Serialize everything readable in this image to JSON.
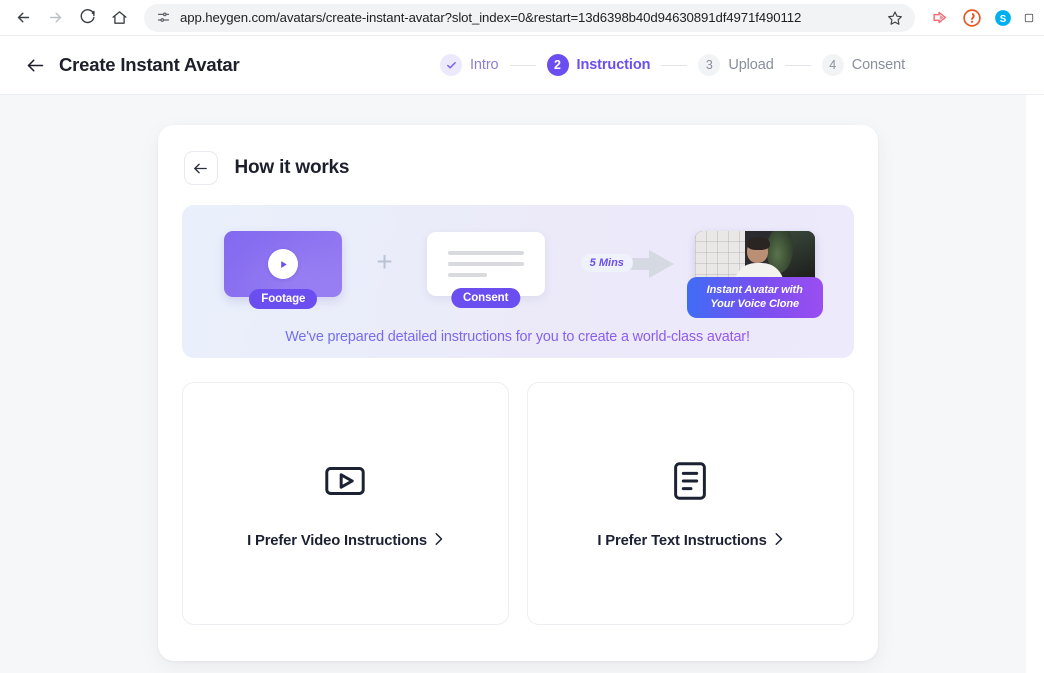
{
  "browser": {
    "back_icon": "arrow-left-icon",
    "forward_icon": "arrow-right-icon",
    "reload_icon": "reload-icon",
    "home_icon": "home-icon",
    "site_info_icon": "site-settings-icon",
    "url": "app.heygen.com/avatars/create-instant-avatar?slot_index=0&restart=13d6398b40d94630891df4971f490112",
    "bookmark_icon": "star-icon",
    "extensions": [
      {
        "name": "extension-icon-red-play",
        "color": "#f06a72"
      },
      {
        "name": "extension-icon-orange-shield",
        "color": "#e8551f"
      },
      {
        "name": "extension-icon-skype",
        "color": "#00aff0"
      },
      {
        "name": "extension-icon-partial",
        "color": "#3c3c3c"
      }
    ]
  },
  "header": {
    "back_label": "back",
    "title": "Create Instant Avatar",
    "steps": [
      {
        "number": "✓",
        "label": "Intro",
        "state": "done"
      },
      {
        "number": "2",
        "label": "Instruction",
        "state": "active"
      },
      {
        "number": "3",
        "label": "Upload",
        "state": "todo"
      },
      {
        "number": "4",
        "label": "Consent",
        "state": "todo"
      }
    ]
  },
  "card": {
    "back_icon": "arrow-left-icon",
    "title": "How it works",
    "banner": {
      "footage_label": "Footage",
      "plus": "+",
      "consent_label": "Consent",
      "duration_label": "5 Mins",
      "result_badge_line1": "Instant Avatar with",
      "result_badge_line2": "Your Voice Clone",
      "tagline": "We've prepared detailed instructions for you to create a world-class avatar!"
    },
    "options": [
      {
        "icon": "video-play-square-icon",
        "label": "I Prefer Video Instructions",
        "chevron": "›"
      },
      {
        "icon": "text-document-square-icon",
        "label": "I Prefer Text Instructions",
        "chevron": "›"
      }
    ]
  },
  "colors": {
    "accent_purple": "#6b4ef0",
    "page_bg": "#f6f7f9",
    "muted_text": "#8a8f9c"
  }
}
